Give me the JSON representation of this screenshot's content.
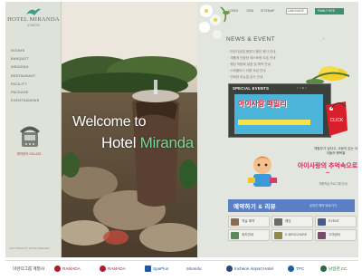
{
  "brand": {
    "logo_text": "HOTEL MIRANDA",
    "logo_sub": "ICHEON"
  },
  "sidebar": {
    "nav": [
      "ROOMS",
      "BANQUET",
      "WEDDING",
      "RESTAURANT",
      "FACILITY",
      "PACKAGE",
      "EVENTS&NEWS"
    ],
    "phone_label": "예약문의 031-633",
    "copyright": "COPYRIGHT BY HOTEL MIRANDA"
  },
  "hero": {
    "line1": "Welcome to",
    "line2_a": "Hotel ",
    "line2_b": "Miranda"
  },
  "topbar": {
    "links": [
      "LOGIN",
      "JOIN",
      "SITEMAP"
    ],
    "language": "LANGUAGE",
    "family_site": "FAMILY SITE"
  },
  "news": {
    "title_a": "NEWS ",
    "title_amp": "&",
    "title_b": " EVENT",
    "more": "+",
    "items": [
      "미란다호텔 봄맞이 할인 행사 안내",
      "새롭게 단장한 레스토랑 오픈 안내",
      "웨딩 박람회 일정 및 예약 안내",
      "스파플러스 이용 요금 안내",
      "연회장 리뉴얼 공사 안내"
    ]
  },
  "special": {
    "title": "SPECIAL EVENTS",
    "dots": "○ ○ ● ○",
    "banner_text": "아이사랑 패밀리",
    "tag_text": "CLICK"
  },
  "promo": {
    "t1": "체험부가 넘치고,\n사랑이 있는\n아이들의 행복을",
    "t2": "아이사랑의\n추억속으로~",
    "t3": "체험학습 프로그램 안내"
  },
  "blue_banner": {
    "title": "예약하기 & 리뷰",
    "sub": "온라인 예약 바로가기"
  },
  "quick_links": [
    {
      "label": "객실 예약",
      "color": "#8a6b4a"
    },
    {
      "label": "웨딩",
      "color": "#6a6a6a"
    },
    {
      "label": "EVENT",
      "color": "#4a5a8a"
    },
    {
      "label": "위치안내",
      "color": "#5a8a5a"
    },
    {
      "label": "E-BROCHURE",
      "color": "#8a8a4a"
    },
    {
      "label": "고객센터",
      "color": "#7a4a6a"
    }
  ],
  "partners": [
    {
      "name": "미란다그룹 계열사",
      "color": "#333333"
    },
    {
      "name": "RAMADA",
      "color": "#b01c2e"
    },
    {
      "name": "RAMADA",
      "color": "#b01c2e"
    },
    {
      "name": "SpaPlus",
      "color": "#1b5aa8"
    },
    {
      "name": "Miranda",
      "color": "#5a3c8c"
    },
    {
      "name": "Incheon Airport Hotel",
      "color": "#2b4a7a"
    },
    {
      "name": "TPC",
      "color": "#1e5fa3"
    },
    {
      "name": "남일관 CC",
      "color": "#2c6b3c"
    }
  ]
}
